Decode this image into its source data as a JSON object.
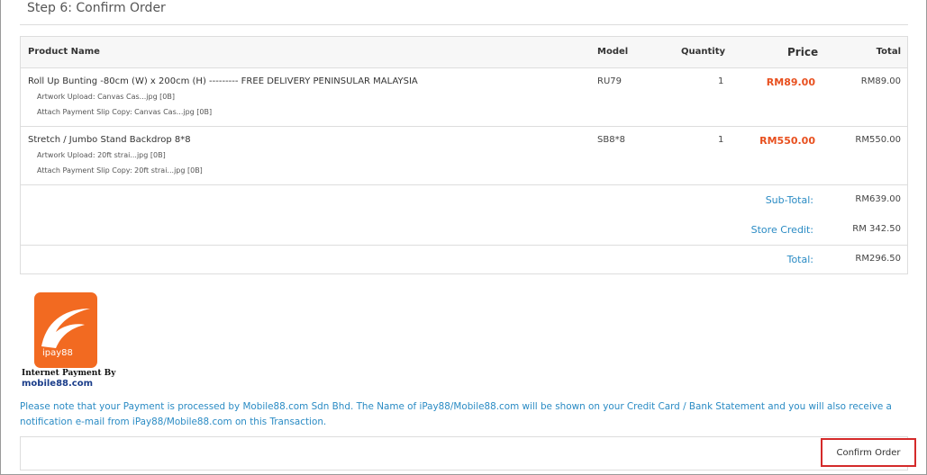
{
  "step": {
    "title": "Step 6: Confirm Order"
  },
  "table": {
    "headers": {
      "product": "Product Name",
      "model": "Model",
      "quantity": "Quantity",
      "price": "Price",
      "total": "Total"
    },
    "items": [
      {
        "name": "Roll Up Bunting -80cm (W) x 200cm (H) --------- FREE DELIVERY PENINSULAR MALAYSIA",
        "options": [
          "Artwork Upload: Canvas Cas...jpg [0B]",
          "Attach Payment Slip Copy: Canvas Cas...jpg [0B]"
        ],
        "model": "RU79",
        "quantity": "1",
        "price": "RM89.00",
        "total": "RM89.00"
      },
      {
        "name": "Stretch / Jumbo Stand Backdrop 8*8",
        "options": [
          "Artwork Upload: 20ft strai...jpg [0B]",
          "Attach Payment Slip Copy: 20ft strai...jpg [0B]"
        ],
        "model": "SB8*8",
        "quantity": "1",
        "price": "RM550.00",
        "total": "RM550.00"
      }
    ],
    "totals": [
      {
        "label": "Sub-Total:",
        "value": "RM639.00"
      },
      {
        "label": "Store Credit:",
        "value": "RM 342.50"
      },
      {
        "label": "Total:",
        "value": "RM296.50"
      }
    ]
  },
  "logo": {
    "brand": "ipay88",
    "line1": "Internet Payment By",
    "line2": "mobile88.com"
  },
  "notice": "Please note that your Payment is processed by Mobile88.com Sdn Bhd. The Name of iPay88/Mobile88.com will be shown on your Credit Card / Bank Statement and you will also receive a notification e-mail from iPay88/Mobile88.com on this Transaction.",
  "confirm_button": "Confirm Order",
  "colors": {
    "accent": "#2a8bc4",
    "price": "#e8501f",
    "logo": "#f26a21",
    "highlight": "#d42a2a"
  }
}
